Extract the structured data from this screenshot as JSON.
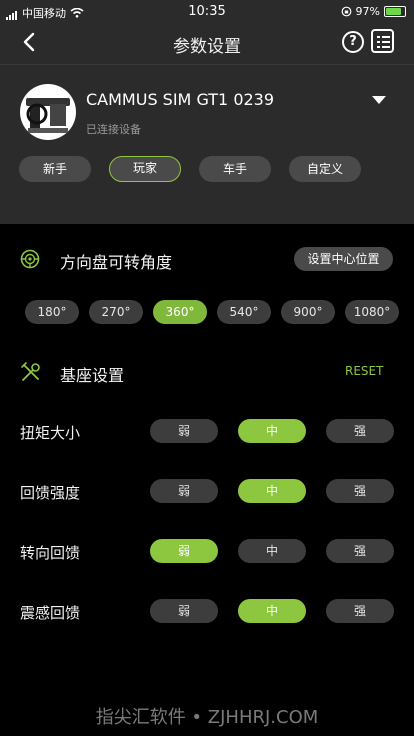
{
  "status_bar": {
    "carrier": "中国移动",
    "time": "10:35",
    "battery": "97%"
  },
  "header": {
    "title": "参数设置"
  },
  "device": {
    "name": "CAMMUS SIM GT1 0239",
    "status": "已连接设备"
  },
  "modes": [
    {
      "label": "新手",
      "active": false
    },
    {
      "label": "玩家",
      "active": true
    },
    {
      "label": "车手",
      "active": false
    },
    {
      "label": "自定义",
      "active": false
    }
  ],
  "steering": {
    "title": "方向盘可转角度",
    "center_button": "设置中心位置",
    "angles": [
      "180°",
      "270°",
      "360°",
      "540°",
      "900°",
      "1080°"
    ],
    "selected_angle": "360°"
  },
  "base": {
    "title": "基座设置",
    "reset_label": "RESET",
    "options": [
      "弱",
      "中",
      "强"
    ],
    "rows": [
      {
        "label": "扭矩大小",
        "selected": "中"
      },
      {
        "label": "回馈强度",
        "selected": "中"
      },
      {
        "label": "转向回馈",
        "selected": "弱"
      },
      {
        "label": "震感回馈",
        "selected": "中"
      }
    ]
  },
  "watermark": "指尖汇软件 • ZJHHRJ.COM",
  "colors": {
    "accent": "#8dc63f",
    "panel": "#2b2b2b",
    "button": "#3d3d3d"
  }
}
